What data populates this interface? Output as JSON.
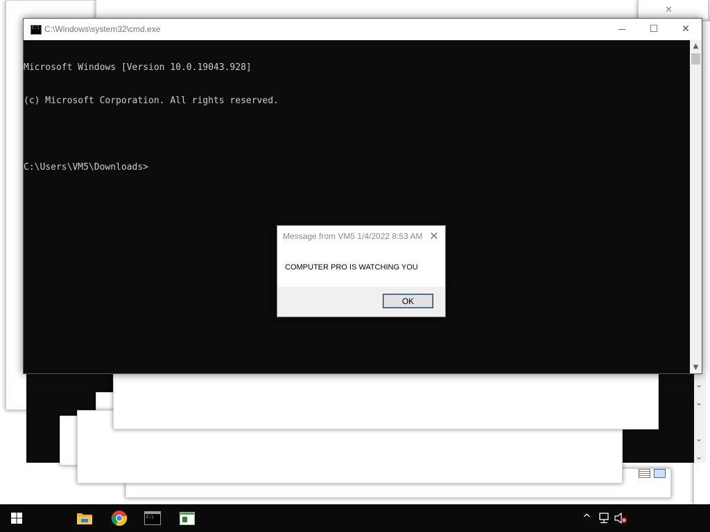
{
  "cmd_window": {
    "title": "C:\\Windows\\system32\\cmd.exe",
    "icon_text": "C:\\",
    "minimize_label": "—",
    "maximize_label": "☐",
    "close_label": "✕",
    "console_lines": [
      "Microsoft Windows [Version 10.0.19043.928]",
      "(c) Microsoft Corporation. All rights reserved.",
      "",
      "C:\\Users\\VM5\\Downloads>"
    ]
  },
  "message_box": {
    "title": "Message from VM5 1/4/2022 8:53 AM",
    "close_label": "✕",
    "text": "COMPUTER PRO IS WATCHING YOU",
    "ok_label": "OK"
  },
  "background_windows": {
    "close_label": "✕"
  },
  "taskbar": {
    "items": [
      {
        "name": "start-button",
        "icon": "windows-logo-icon"
      },
      {
        "name": "file-explorer",
        "icon": "folder-icon"
      },
      {
        "name": "chrome",
        "icon": "chrome-icon"
      },
      {
        "name": "command-prompt",
        "icon": "cmd-icon"
      },
      {
        "name": "notepad-app",
        "icon": "app-window-icon"
      }
    ],
    "tray": {
      "chevron": "^",
      "network_icon": "network-icon",
      "volume_icon": "volume-muted-icon"
    }
  },
  "colors": {
    "console_bg": "#0c0c0c",
    "console_fg": "#cccccc",
    "taskbar_bg": "#0a0a0a",
    "ok_focus": "#7aa7e0",
    "mute_badge": "#e81123"
  }
}
